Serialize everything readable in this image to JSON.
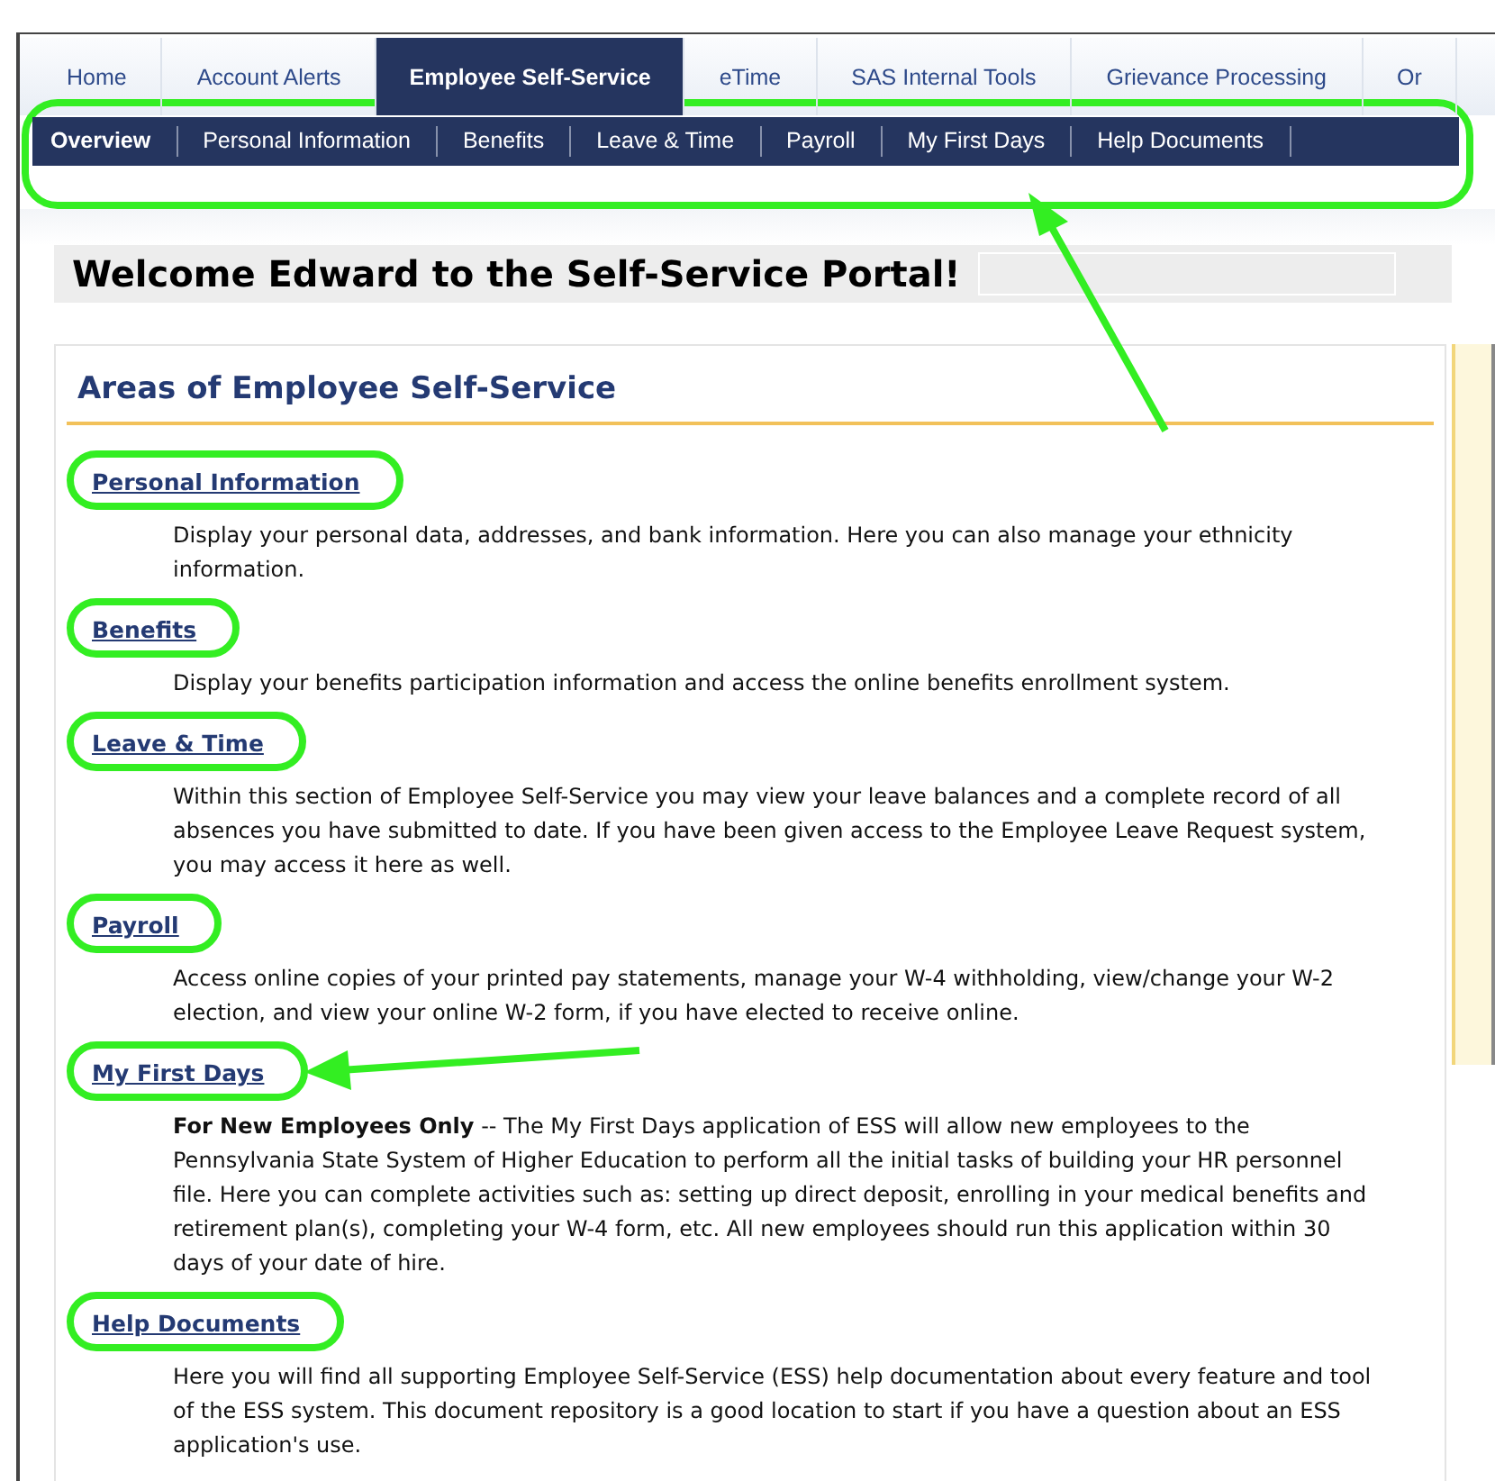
{
  "tabs": [
    {
      "label": "Home",
      "selected": false
    },
    {
      "label": "Account Alerts",
      "selected": false
    },
    {
      "label": "Employee Self-Service",
      "selected": true
    },
    {
      "label": "eTime",
      "selected": false
    },
    {
      "label": "SAS Internal Tools",
      "selected": false
    },
    {
      "label": "Grievance Processing",
      "selected": false
    },
    {
      "label": "Or",
      "selected": false
    }
  ],
  "subnav": {
    "highlighted": true,
    "items": [
      {
        "label": "Overview",
        "selected": true
      },
      {
        "label": "Personal Information",
        "selected": false
      },
      {
        "label": "Benefits",
        "selected": false
      },
      {
        "label": "Leave & Time",
        "selected": false
      },
      {
        "label": "Payroll",
        "selected": false
      },
      {
        "label": "My First Days",
        "selected": false
      },
      {
        "label": "Help Documents",
        "selected": false
      }
    ]
  },
  "welcome": {
    "title": "Welcome Edward to the Self-Service Portal!"
  },
  "areas": {
    "heading": "Areas of Employee Self-Service",
    "sections": [
      {
        "title": "Personal Information",
        "highlighted": true,
        "description": "Display your personal data, addresses, and bank information. Here you can also manage your ethnicity information."
      },
      {
        "title": "Benefits",
        "highlighted": true,
        "description": "Display your benefits participation information and access the online benefits enrollment system."
      },
      {
        "title": "Leave & Time",
        "highlighted": true,
        "description": "Within this section of Employee Self-Service you may view your leave balances and a complete record of all absences you have submitted to date. If you have been given access to the Employee Leave Request system, you may access it here as well."
      },
      {
        "title": "Payroll",
        "highlighted": true,
        "description": "Access online copies of your printed pay statements, manage your W-4 withholding, view/change your W-2 election, and view your online W-2 form, if you have elected to receive online."
      },
      {
        "title": "My First Days",
        "highlighted": true,
        "description": "**For New Employees Only** -- The My First Days application of ESS will allow new employees to the Pennsylvania State System of Higher Education to perform all the initial tasks of building your HR personnel file. Here you can complete activities such as: setting up direct deposit, enrolling in your medical benefits and retirement plan(s), completing your W-4 form, etc. All new employees should run this application within 30 days of your date of hire."
      },
      {
        "title": "Help Documents",
        "highlighted": true,
        "description": "Here you will find all supporting Employee Self-Service (ESS) help documentation about every feature and tool of the ESS system. This document repository is a good location to start if you have a question about an ESS application's use."
      }
    ]
  }
}
